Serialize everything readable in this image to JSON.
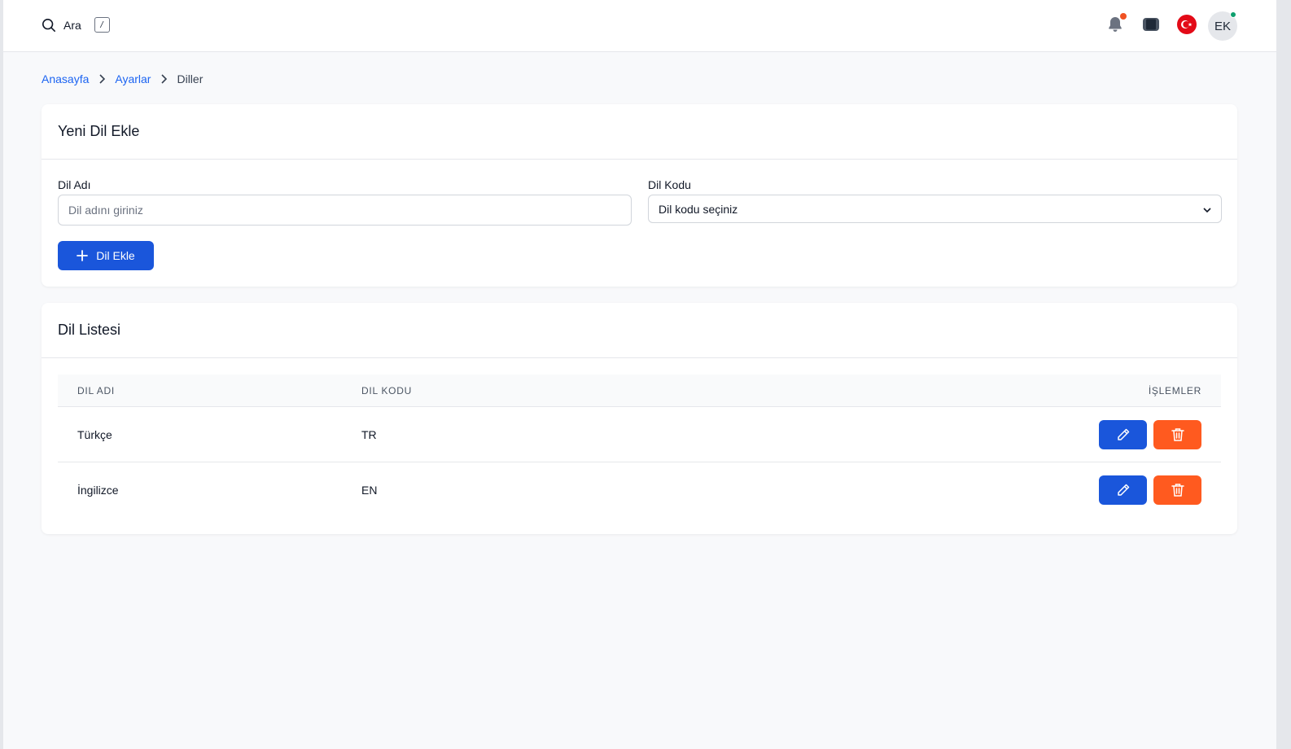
{
  "colors": {
    "primary": "#1a56db",
    "danger": "#ff5a1f",
    "notification_dot": "#f05223",
    "online_dot": "#0e9f6e",
    "link": "#1c64f2"
  },
  "topbar": {
    "search_label": "Ara",
    "search_shortcut": "/",
    "icons": [
      "search-icon",
      "bell-icon",
      "apps-icon",
      "turkey-flag-icon"
    ],
    "avatar_initials": "EK"
  },
  "breadcrumb": {
    "items": [
      "Anasayfa",
      "Ayarlar"
    ],
    "current": "Diller"
  },
  "add_form": {
    "title": "Yeni Dil Ekle",
    "name_label": "Dil Adı",
    "name_placeholder": "Dil adını giriniz",
    "name_value": "",
    "code_label": "Dil Kodu",
    "code_selected": "Dil kodu seçiniz",
    "submit_label": "Dil Ekle"
  },
  "list": {
    "title": "Dil Listesi",
    "columns": [
      "DIL ADI",
      "DIL KODU",
      "İŞLEMLER"
    ],
    "rows": [
      {
        "name": "Türkçe",
        "code": "TR"
      },
      {
        "name": "İngilizce",
        "code": "EN"
      }
    ]
  }
}
